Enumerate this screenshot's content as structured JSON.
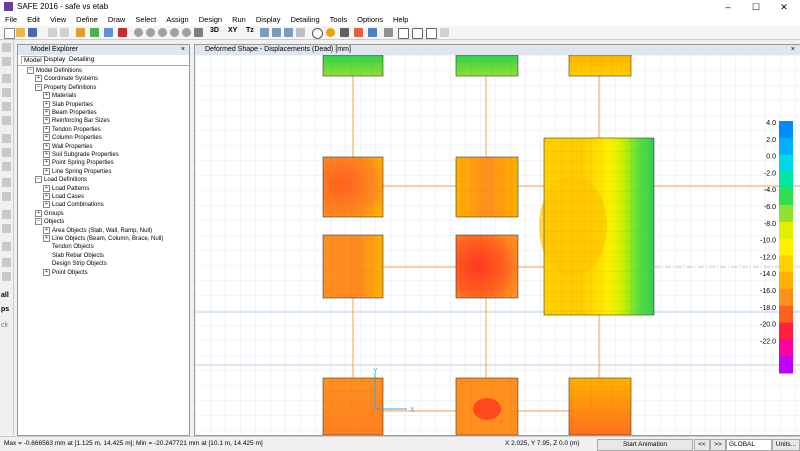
{
  "window": {
    "title": "SAFE 2016 - safe vs etab"
  },
  "menu": [
    "File",
    "Edit",
    "View",
    "Define",
    "Draw",
    "Select",
    "Assign",
    "Design",
    "Run",
    "Display",
    "Detailing",
    "Tools",
    "Options",
    "Help"
  ],
  "toolbar_text": {
    "t3d": "3D",
    "txy": "XY",
    "tz": "Tz"
  },
  "left_toolbar_text": {
    "all": "all",
    "ps": "ps",
    "clr": "clr"
  },
  "explorer": {
    "title": "Model Explorer",
    "close": "×",
    "tabs": [
      "Model",
      "Display",
      "Detailing"
    ],
    "tree": [
      {
        "label": "Model Definitions",
        "level": 0,
        "exp": "−"
      },
      {
        "label": "Coordinate Systems",
        "level": 1,
        "exp": "+"
      },
      {
        "label": "Property Definitions",
        "level": 1,
        "exp": "−"
      },
      {
        "label": "Materials",
        "level": 2,
        "exp": "+"
      },
      {
        "label": "Slab Properties",
        "level": 2,
        "exp": "+"
      },
      {
        "label": "Beam Properties",
        "level": 2,
        "exp": "+"
      },
      {
        "label": "Reinforcing Bar Sizes",
        "level": 2,
        "exp": "+"
      },
      {
        "label": "Tendon Properties",
        "level": 2,
        "exp": "+"
      },
      {
        "label": "Column Properties",
        "level": 2,
        "exp": "+"
      },
      {
        "label": "Wall Properties",
        "level": 2,
        "exp": "+"
      },
      {
        "label": "Soil Subgrade Properties",
        "level": 2,
        "exp": "+"
      },
      {
        "label": "Point Spring Properties",
        "level": 2,
        "exp": "+"
      },
      {
        "label": "Line Spring Properties",
        "level": 2,
        "exp": "+"
      },
      {
        "label": "Load Definitions",
        "level": 1,
        "exp": "−"
      },
      {
        "label": "Load Patterns",
        "level": 2,
        "exp": "+"
      },
      {
        "label": "Load Cases",
        "level": 2,
        "exp": "+"
      },
      {
        "label": "Load Combinations",
        "level": 2,
        "exp": "+"
      },
      {
        "label": "Groups",
        "level": 1,
        "exp": "+"
      },
      {
        "label": "Objects",
        "level": 1,
        "exp": "−"
      },
      {
        "label": "Area Objects (Slab, Wall, Ramp, Null)",
        "level": 2,
        "exp": "+"
      },
      {
        "label": "Line Objects (Beam, Column, Brace, Null)",
        "level": 2,
        "exp": "+"
      },
      {
        "label": "Tendon Objects",
        "level": 2,
        "exp": ""
      },
      {
        "label": "Slab Rebar Objects",
        "level": 2,
        "exp": ""
      },
      {
        "label": "Design Strip Objects",
        "level": 2,
        "exp": ""
      },
      {
        "label": "Point Objects",
        "level": 2,
        "exp": "+"
      }
    ]
  },
  "viewport": {
    "title": "Deformed Shape - Displacements (Dead)  [mm]",
    "close": "×",
    "axis_y": "Y",
    "axis_x": "X",
    "legend": [
      {
        "label": "4.0",
        "color": "#008cff"
      },
      {
        "label": "2.0",
        "color": "#00b0ff"
      },
      {
        "label": "0.0",
        "color": "#00d8e8"
      },
      {
        "label": "-2.0",
        "color": "#00e8a0"
      },
      {
        "label": "-4.0",
        "color": "#30e050"
      },
      {
        "label": "-6.0",
        "color": "#90e030"
      },
      {
        "label": "-8.0",
        "color": "#e0f000"
      },
      {
        "label": "-10.0",
        "color": "#fff000"
      },
      {
        "label": "-12.0",
        "color": "#ffd000"
      },
      {
        "label": "-14.0",
        "color": "#ffb000"
      },
      {
        "label": "-16.0",
        "color": "#ff9020"
      },
      {
        "label": "-18.0",
        "color": "#ff6020"
      },
      {
        "label": "-20.0",
        "color": "#ff2040"
      },
      {
        "label": "-22.0",
        "color": "#ff00a0"
      },
      {
        "label": "",
        "color": "#c000ff"
      }
    ]
  },
  "status": {
    "minmax": "Max = -0.666563 mm at [1.125 m, 14.425 m];  Min = -20.247721 mm at [10.1 m, 14.425 m]",
    "coords": "X 2.025,  Y 7.95,  Z 0.0  (m)",
    "animation_button": "Start Animation",
    "prev": "<<",
    "next": ">>",
    "coord_system": "GLOBAL",
    "units_button": "Units..."
  },
  "colors": {
    "title_icon": "#6a3d9a",
    "grid": "#c6dcec",
    "frame": "#f5a34a",
    "panel_border": "#3a3a3a"
  }
}
